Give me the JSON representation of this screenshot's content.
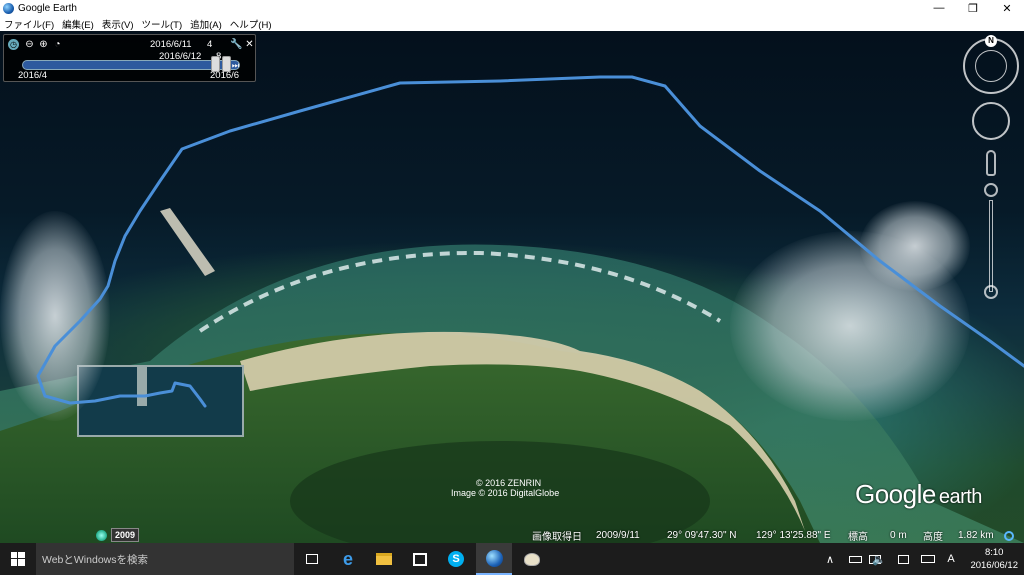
{
  "window": {
    "title": "Google Earth",
    "controls": {
      "minimize": "—",
      "maximize": "❐",
      "close": "✕"
    }
  },
  "menu": [
    "ファイル(F)",
    "編集(E)",
    "表示(V)",
    "ツール(T)",
    "追加(A)",
    "ヘルプ(H)"
  ],
  "time_slider": {
    "current_date": "2016/6/11",
    "current_suffix": "4",
    "hover_date": "2016/6/12",
    "hover_suffix": "8",
    "range_start": "2016/4",
    "range_end": "2016/6",
    "position": 0.93
  },
  "map": {
    "copyright_zenrin": "© 2016 ZENRIN",
    "copyright_image": "Image © 2016 DigitalGlobe",
    "logo_main": "Google",
    "logo_sub": "earth",
    "path_color": "#4a8fd8"
  },
  "status": {
    "capture_label": "画像取得日",
    "capture_date": "2009/9/11",
    "lat": "29° 09'47.30\" N",
    "lon": "129° 13'25.88\" E",
    "elev_label": "標高",
    "elev_value": "0 m",
    "alt_label": "高度",
    "alt_value": "1.82 km",
    "historical_year": "2009"
  },
  "taskbar": {
    "search_placeholder": "WebとWindowsを検索",
    "time": "8:10",
    "date": "2016/06/12",
    "ime": "A"
  }
}
